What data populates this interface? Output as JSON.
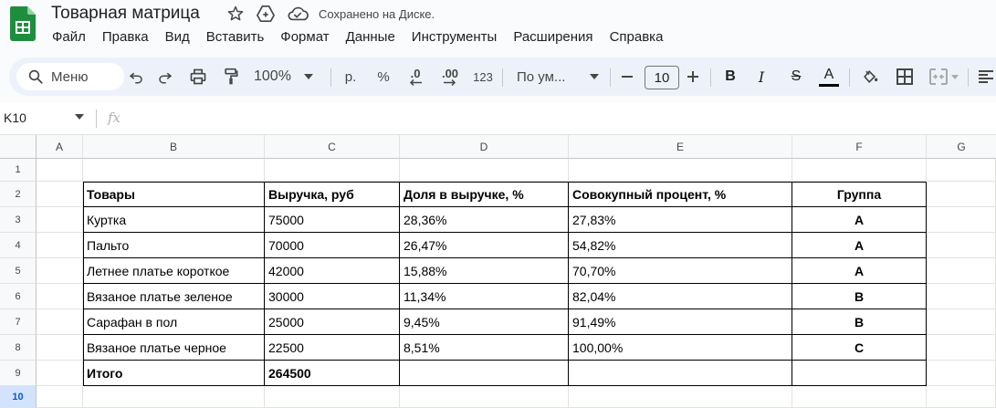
{
  "app": {
    "doc_title": "Товарная матрица",
    "saved_status": "Сохранено на Диске.",
    "menu": [
      "Файл",
      "Правка",
      "Вид",
      "Вставить",
      "Формат",
      "Данные",
      "Инструменты",
      "Расширения",
      "Справка"
    ],
    "accent_color": "#1e8e3e"
  },
  "toolbar": {
    "search_label": "Меню",
    "zoom": "100%",
    "currency": "р.",
    "percent": "%",
    "decrease_decimals": ".0",
    "increase_decimals": ".00",
    "number_format": "123",
    "font_name": "По ум...",
    "font_size": "10",
    "bold": "B",
    "italic": "I",
    "strike": "S",
    "text_color": "A"
  },
  "formula_bar": {
    "cell_ref": "K10",
    "fx_label": "fx"
  },
  "sheet": {
    "columns": [
      "A",
      "B",
      "C",
      "D",
      "E",
      "F",
      "G"
    ],
    "rows": [
      "1",
      "2",
      "3",
      "4",
      "5",
      "6",
      "7",
      "8",
      "9",
      "10"
    ],
    "active_row": "10",
    "header": [
      "Товары",
      "Выручка, руб",
      "Доля в выручке, %",
      "Совокупный процент, %",
      "Группа"
    ],
    "data": [
      [
        "Куртка",
        "75000",
        "28,36%",
        "27,83%",
        "A"
      ],
      [
        "Пальто",
        "70000",
        "26,47%",
        "54,82%",
        "A"
      ],
      [
        "Летнее платье короткое",
        "42000",
        "15,88%",
        "70,70%",
        "A"
      ],
      [
        "Вязаное платье зеленое",
        "30000",
        "11,34%",
        "82,04%",
        "B"
      ],
      [
        "Сарафан в пол",
        "25000",
        "9,45%",
        "91,49%",
        "B"
      ],
      [
        "Вязаное платье черное",
        "22500",
        "8,51%",
        "100,00%",
        "C"
      ]
    ],
    "total": [
      "Итого",
      "264500",
      "",
      "",
      ""
    ]
  }
}
